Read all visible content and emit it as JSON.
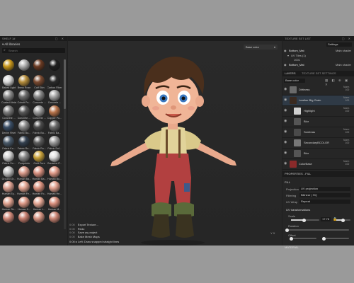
{
  "left_panel": {
    "title": "SHELF 1#",
    "header": "All libraries",
    "search_placeholder": "Search",
    "materials": [
      {
        "label": "",
        "color": "#c8961a"
      },
      {
        "label": "",
        "color": "#b0b0b0"
      },
      {
        "label": "",
        "color": "#6b3a22"
      },
      {
        "label": "",
        "color": "#1e1e1e"
      },
      {
        "label": "Baked Light",
        "color": "#d7d7d7"
      },
      {
        "label": "Brass Rose",
        "color": "#b58d3c"
      },
      {
        "label": "Calf Skin",
        "color": "#7a4a30"
      },
      {
        "label": "Carbon Fiber",
        "color": "#2a2a2a"
      },
      {
        "label": "Coated Metal",
        "color": "#8c8c8c"
      },
      {
        "label": "Cobalt Pu...",
        "color": "#6d6d6d"
      },
      {
        "label": "Concrete ...",
        "color": "#878787"
      },
      {
        "label": "Concrete ...",
        "color": "#a6a6a6"
      },
      {
        "label": "Concrete ...",
        "color": "#7b7b7b"
      },
      {
        "label": "Concrete ...",
        "color": "#585858"
      },
      {
        "label": "Concrete ...",
        "color": "#9a9a9a"
      },
      {
        "label": "Copper Pu...",
        "color": "#b8734a"
      },
      {
        "label": "Denim Rivet",
        "color": "#3a4e66"
      },
      {
        "label": "Fabric Ba...",
        "color": "#8a8a8a"
      },
      {
        "label": "Fabric Ba...",
        "color": "#4b4b4b"
      },
      {
        "label": "Fabric Ba...",
        "color": "#6b6b6b"
      },
      {
        "label": "Fabric Kn...",
        "color": "#4a5a6a"
      },
      {
        "label": "Fabric Ro...",
        "color": "#33404f"
      },
      {
        "label": "Fabric Ro...",
        "color": "#5d5d5d"
      },
      {
        "label": "Fabric Sof...",
        "color": "#9a9a9a"
      },
      {
        "label": "Fabric Su...",
        "color": "#d0d0d0"
      },
      {
        "label": "Footprints",
        "color": "#8a8a8a"
      },
      {
        "label": "Gold Pure",
        "color": "#c9a23a"
      },
      {
        "label": "Gouache P...",
        "color": "#e0e0e0"
      },
      {
        "label": "Ground Gr...",
        "color": "#c0c0c0"
      },
      {
        "label": "Human Ba...",
        "color": "#d99a8a"
      },
      {
        "label": "Human Ba...",
        "color": "#d8907f"
      },
      {
        "label": "Human Bu...",
        "color": "#e09a88"
      },
      {
        "label": "Human Ey...",
        "color": "#dca090"
      },
      {
        "label": "Human Fe...",
        "color": "#e3a592"
      },
      {
        "label": "Human Fo...",
        "color": "#d9907c"
      },
      {
        "label": "Human He...",
        "color": "#e2a08e"
      },
      {
        "label": "Human Sk...",
        "color": "#e0a28f"
      },
      {
        "label": "Human K...",
        "color": "#dc9886"
      },
      {
        "label": "Human L...",
        "color": "#e5a794"
      },
      {
        "label": "Human M...",
        "color": "#d98f7d"
      },
      {
        "label": "",
        "color": "#d08878"
      },
      {
        "label": "",
        "color": "#c77e6e"
      },
      {
        "label": "",
        "color": "#d59280"
      },
      {
        "label": "",
        "color": "#cc8574"
      }
    ]
  },
  "viewport": {
    "dropdown": "Base color",
    "log": [
      {
        "time": "0:00",
        "text": "Export Texture..."
      },
      {
        "time": "0:00",
        "text": "Redo"
      },
      {
        "time": "0:00",
        "text": "Save as project"
      },
      {
        "time": "0:00",
        "text": "Bake Mesh Maps"
      }
    ],
    "hint": "0:00 ▸ Left: Draw snapped straight lines",
    "axis_label": "Y X"
  },
  "texture_set": {
    "title": "TEXTURE SET LIST",
    "settings": "Settings",
    "item1": "Bottom_Mat",
    "item1_shader": "Main shader",
    "uv_tiles": "UV Tiles (1)",
    "tile": "1001",
    "item2": "Bottom_Mat",
    "item2_shader": "Main shader"
  },
  "layers": {
    "tab1": "LAYERS",
    "tab2": "TEXTURE SET SETTINGS",
    "base_color": "Base color",
    "items": [
      {
        "name": "Dirtiness",
        "blend": "Norm",
        "opacity": "100",
        "thumb": "#6b6b6b",
        "sub": false
      },
      {
        "name": "Leather Big Grain",
        "blend": "Norm",
        "opacity": "100",
        "thumb": "#3a2a20",
        "sub": false
      },
      {
        "name": "Highlight",
        "blend": "Norm",
        "opacity": "100",
        "thumb": "#d0d0d0",
        "sub": true
      },
      {
        "name": "Blur",
        "blend": "",
        "opacity": "",
        "thumb": "#555555",
        "sub": true
      },
      {
        "name": "Sombras",
        "blend": "Norm",
        "opacity": "100",
        "thumb": "#4a4a4a",
        "sub": true
      },
      {
        "name": "SecondaryBCOLOR",
        "blend": "Norm",
        "opacity": "100",
        "thumb": "#777777",
        "sub": true
      },
      {
        "name": "Blur",
        "blend": "",
        "opacity": "",
        "thumb": "#555555",
        "sub": true
      },
      {
        "name": "ColorBase",
        "blend": "Norm",
        "opacity": "100",
        "thumb": "#8a2a2a",
        "sub": false
      }
    ]
  },
  "properties": {
    "title": "PROPERTIES - FILL",
    "fill": "FILL",
    "projection_label": "Projection",
    "projection_value": "UV projection",
    "filtering_label": "Filtering",
    "filtering_value": "Bilinear | HQ",
    "uvwrap_label": "UV Wrap",
    "uvwrap_value": "Repeat",
    "uv_transform": "UV transformations",
    "scale_label": "Scale",
    "scale_value": "17.78",
    "rotation_label": "Rotation",
    "rotation_value": "0",
    "offset_label": "Offset",
    "offset_value": "0",
    "material": "MATERIAL"
  },
  "colors": {
    "accent": "#e9a23b",
    "panel": "#262626",
    "viewport": "#282828"
  }
}
